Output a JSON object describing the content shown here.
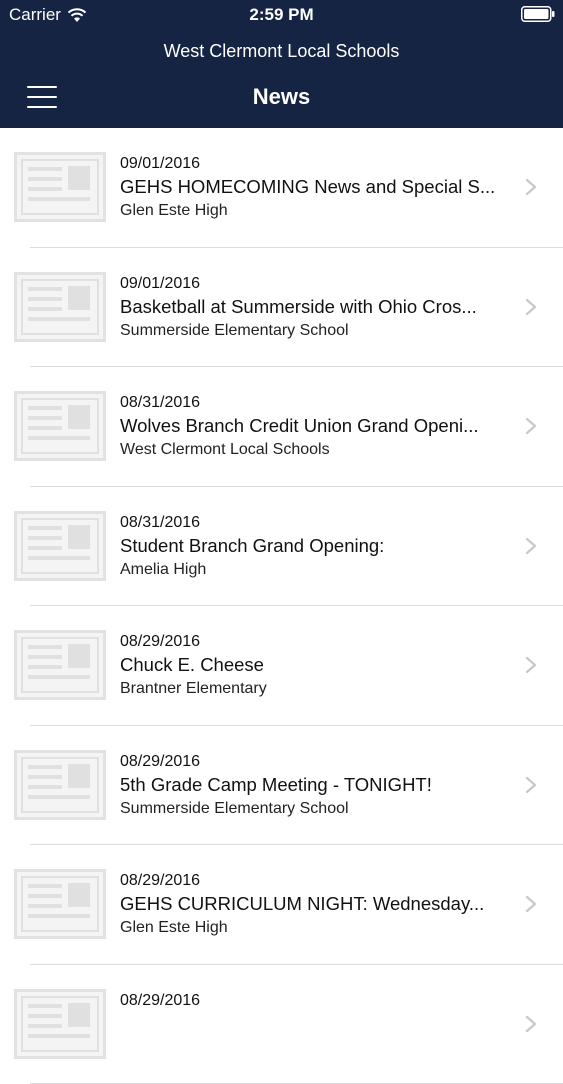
{
  "status_bar": {
    "carrier": "Carrier",
    "time": "2:59 PM",
    "wifi_icon": "wifi-icon",
    "battery_icon": "battery-icon"
  },
  "header": {
    "subtitle": "West Clermont Local Schools",
    "title": "News",
    "menu_icon": "hamburger-menu-icon",
    "background_color": "#152443"
  },
  "news": [
    {
      "date": "09/01/2016",
      "title": "GEHS HOMECOMING News and Special S...",
      "source": "Glen Este High"
    },
    {
      "date": "09/01/2016",
      "title": "Basketball at Summerside with Ohio Cros...",
      "source": "Summerside Elementary School"
    },
    {
      "date": "08/31/2016",
      "title": "Wolves Branch Credit Union Grand Openi...",
      "source": "West Clermont Local Schools"
    },
    {
      "date": "08/31/2016",
      "title": "Student Branch Grand Opening:",
      "source": "Amelia High"
    },
    {
      "date": "08/29/2016",
      "title": "Chuck E. Cheese",
      "source": "Brantner Elementary"
    },
    {
      "date": "08/29/2016",
      "title": "5th Grade Camp Meeting - TONIGHT!",
      "source": "Summerside Elementary School"
    },
    {
      "date": "08/29/2016",
      "title": "GEHS CURRICULUM NIGHT: Wednesday...",
      "source": "Glen Este High"
    },
    {
      "date": "08/29/2016",
      "title": "",
      "source": ""
    }
  ],
  "icons": {
    "thumbnail": "newspaper-icon",
    "row_disclosure": "chevron-right-icon"
  }
}
